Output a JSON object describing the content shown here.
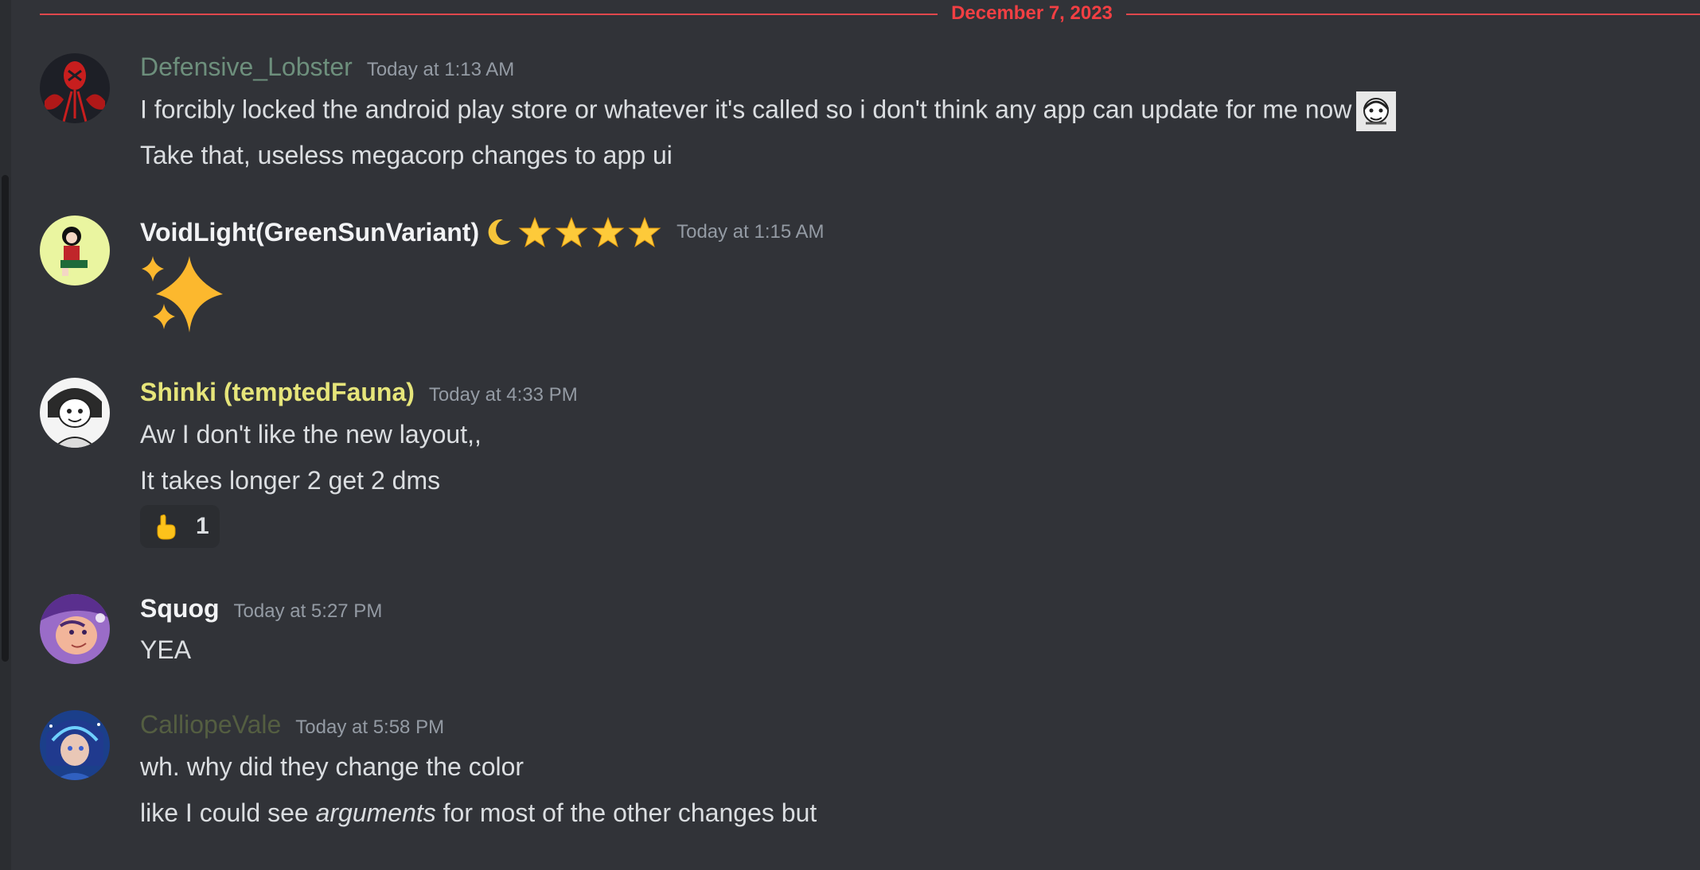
{
  "date_divider": "December 7, 2023",
  "colors": {
    "background": "#313338",
    "divider": "#f23f43",
    "timestamp": "#949ba4",
    "text": "#dbdee1"
  },
  "messages": [
    {
      "username": "Defensive_Lobster",
      "username_color": "#6d8f7c",
      "timestamp": "Today at 1:13 AM",
      "lines": [
        "I forcibly locked the android play store or whatever it's called so i don't think any app can update for me now",
        "Take that, useless megacorp changes to app ui"
      ],
      "inline_emoji": "custom-face-emoji"
    },
    {
      "username": "VoidLight(GreenSunVariant)",
      "username_color": "#f2f3f5",
      "timestamp": "Today at 1:15 AM",
      "badges": [
        "moon-icon",
        "star-icon",
        "star-icon",
        "star-icon",
        "star-icon"
      ],
      "jumbo_emoji": "sparkles-emoji"
    },
    {
      "username": "Shinki (temptedFauna)",
      "username_color": "#e6e57a",
      "timestamp": "Today at 4:33 PM",
      "lines": [
        "Aw I don't like the new layout,,",
        "It takes longer 2 get 2 dms"
      ],
      "reaction": {
        "emoji": "pointing-hand-emoji",
        "count": "1"
      }
    },
    {
      "username": "Squog",
      "username_color": "#f2f3f5",
      "timestamp": "Today at 5:27 PM",
      "lines": [
        "YEA"
      ]
    },
    {
      "username": "CalliopeVale",
      "username_color": "#545e41",
      "timestamp": "Today at 5:58 PM",
      "lines": [
        "wh. why did they change the color",
        "like I could see "
      ],
      "line2_italic": "arguments",
      "line2_tail": " for most of the other changes but"
    }
  ]
}
